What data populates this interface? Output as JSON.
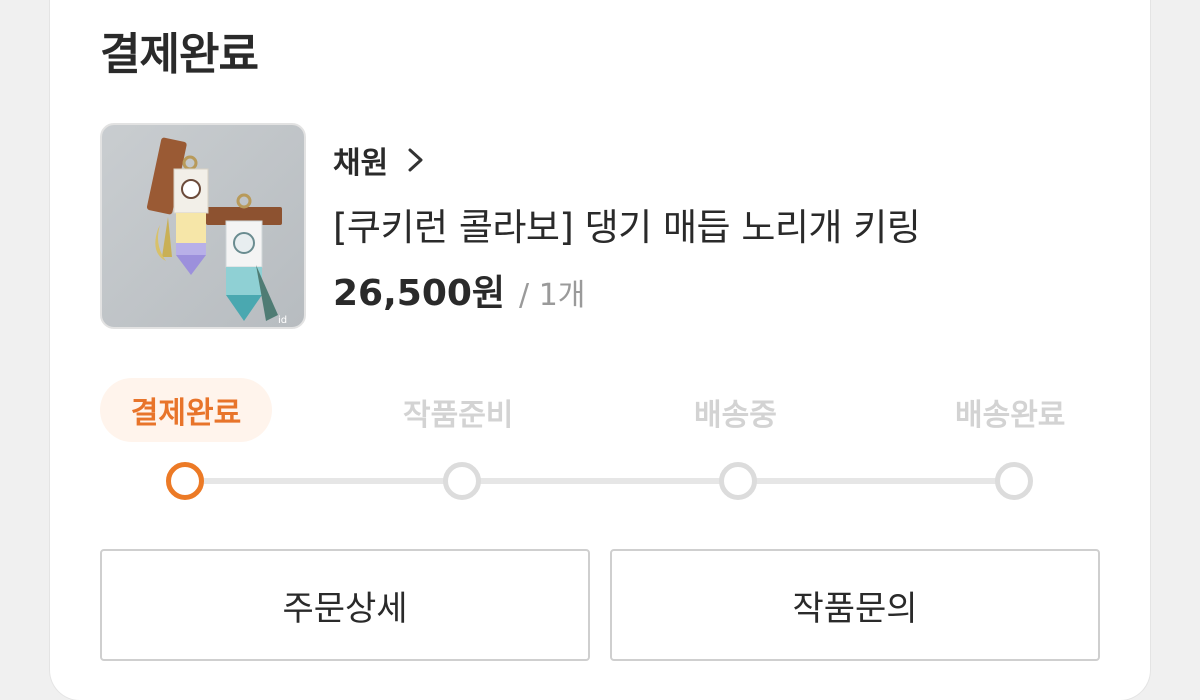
{
  "header": {
    "title": "결제완료"
  },
  "product": {
    "seller": "채원",
    "name": "[쿠키런 콜라보] 댕기 매듭 노리개 키링",
    "price": "26,500원",
    "quantity": "/ 1개",
    "image_icon": "keyring-product-photo"
  },
  "progress": {
    "steps": [
      {
        "label": "결제완료",
        "active": true
      },
      {
        "label": "작품준비",
        "active": false
      },
      {
        "label": "배송중",
        "active": false
      },
      {
        "label": "배송완료",
        "active": false
      }
    ],
    "current_step": 1,
    "accent_color": "#ec7a26"
  },
  "actions": {
    "order_detail": "주문상세",
    "inquiry": "작품문의"
  }
}
